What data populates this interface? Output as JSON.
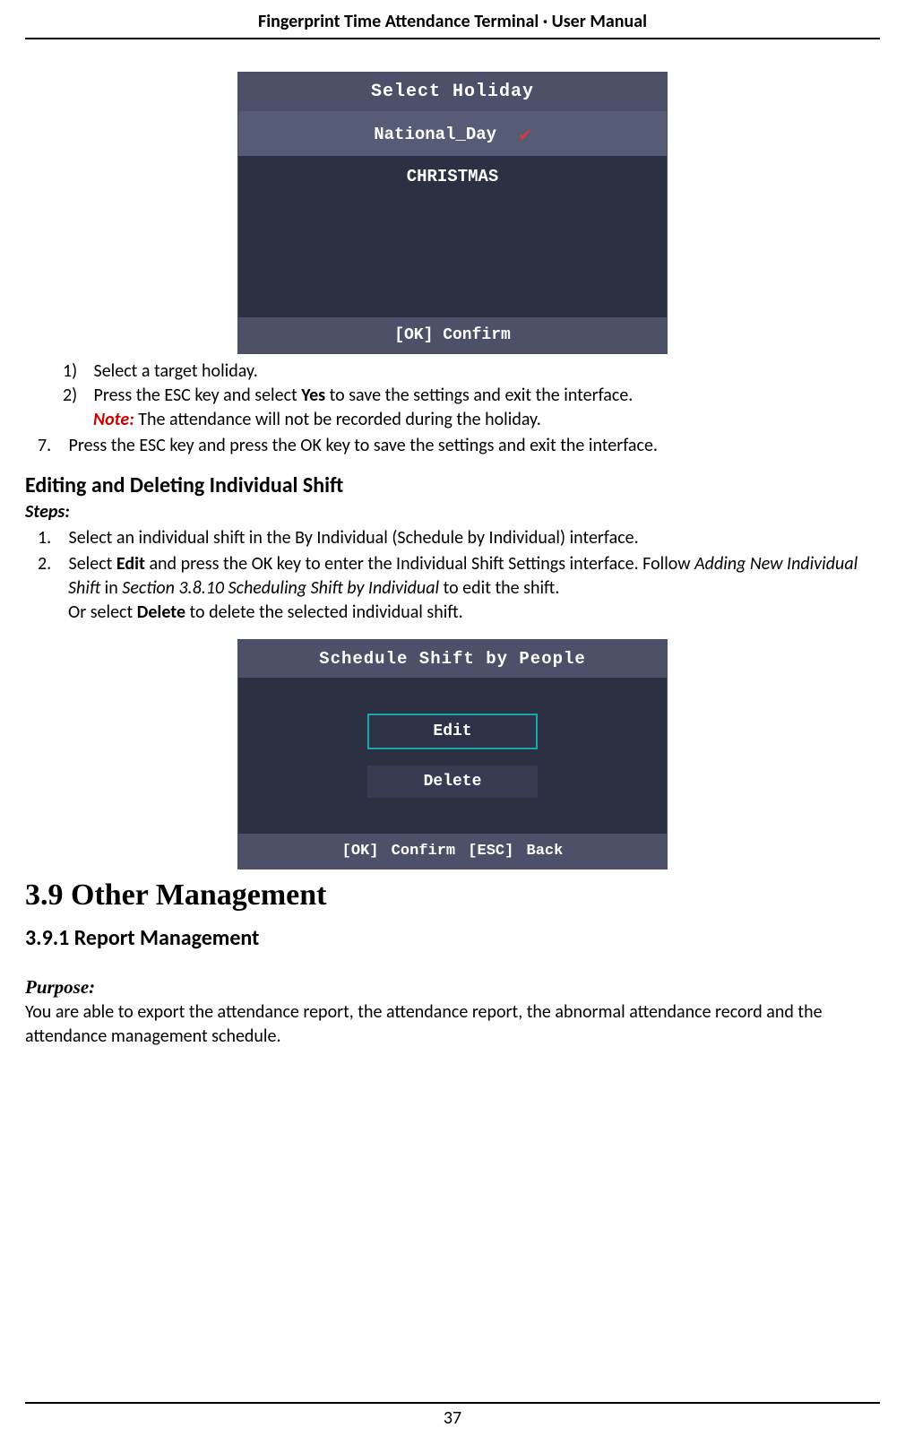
{
  "header": {
    "title": "Fingerprint Time Attendance Terminal · User Manual"
  },
  "terminal1": {
    "title": "Select Holiday",
    "item_selected": "National_Day",
    "item2": "CHRISTMAS",
    "footer": "[OK] Confirm"
  },
  "steps_inner": {
    "m1": "1)",
    "t1": "Select a target holiday.",
    "m2": "2)",
    "t2a": "Press the ESC key and select ",
    "t2b_bold": "Yes",
    "t2c": " to save the settings and exit the interface.",
    "note_label": "Note:",
    "note_text": " The attendance will not be recorded during the holiday."
  },
  "step7": {
    "marker": "7.",
    "text": "Press the ESC key and press the OK key to save the settings and exit the interface."
  },
  "editing": {
    "heading": "Editing and Deleting Individual Shift",
    "steps_label": "Steps:",
    "m1": "1.",
    "t1": "Select an individual shift in the By Individual (Schedule by Individual) interface.",
    "m2": "2.",
    "t2a": "Select ",
    "t2b_bold": "Edit",
    "t2c": " and press the OK key to enter the Individual Shift Settings interface. Follow ",
    "t2d_italic": "Adding New Individual Shift",
    "t2e": " in ",
    "t2f_italic": "Section 3.8.10 Scheduling Shift by Individual",
    "t2g": " to edit the shift.",
    "t2h": "Or select ",
    "t2i_bold": "Delete",
    "t2j": " to delete the selected individual shift."
  },
  "terminal2": {
    "title": "Schedule Shift by People",
    "btn_edit": "Edit",
    "btn_delete": "Delete",
    "footer": "[OK] Confirm   [ESC] Back"
  },
  "section": {
    "heading": "3.9 Other Management",
    "subheading": "3.9.1   Report Management",
    "purpose_label": "Purpose:",
    "purpose_text": "You are able to export the attendance report, the attendance report, the abnormal attendance record and the attendance management schedule."
  },
  "footer": {
    "page_number": "37"
  }
}
